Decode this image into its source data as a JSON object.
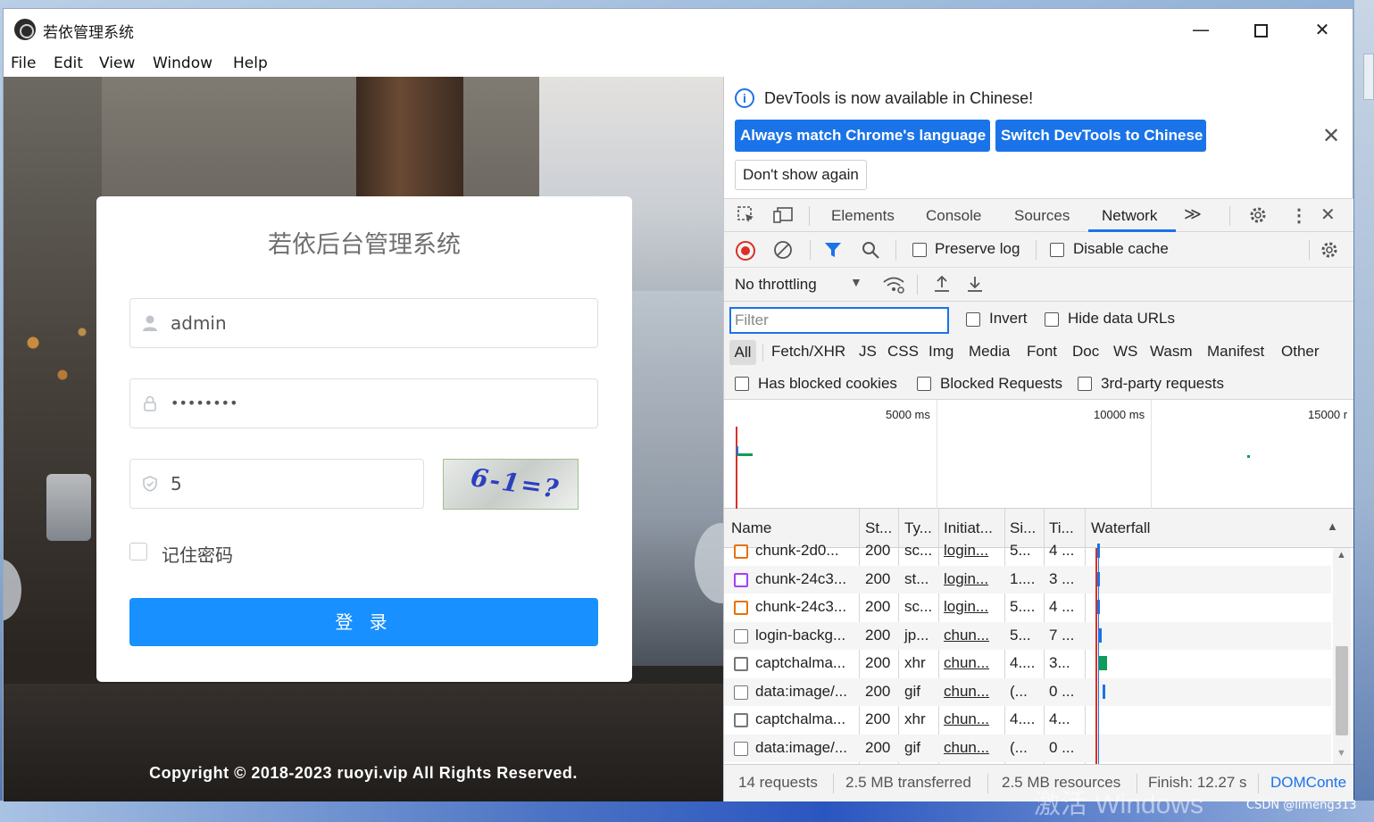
{
  "window": {
    "title": "若依管理系统",
    "min": "—",
    "close": "✕"
  },
  "menu": [
    "File",
    "Edit",
    "View",
    "Window",
    "Help"
  ],
  "login": {
    "title": "若依后台管理系统",
    "username": "admin",
    "password": "••••••••",
    "code": "5",
    "captcha_text": "6-1=?",
    "remember_label": "记住密码",
    "submit_label": "登 录",
    "copyright": "Copyright © 2018-2023 ruoyi.vip All Rights Reserved."
  },
  "devtools": {
    "info_text": "DevTools is now available in Chinese!",
    "btn_match": "Always match Chrome's language",
    "btn_switch": "Switch DevTools to Chinese",
    "btn_dont": "Don't show again",
    "tabs": [
      "Elements",
      "Console",
      "Sources",
      "Network"
    ],
    "more_tabs": "≫",
    "preserve_log": "Preserve log",
    "disable_cache": "Disable cache",
    "throttling": "No throttling",
    "filter_placeholder": "Filter",
    "invert": "Invert",
    "hide_data_urls": "Hide data URLs",
    "types": [
      "All",
      "Fetch/XHR",
      "JS",
      "CSS",
      "Img",
      "Media",
      "Font",
      "Doc",
      "WS",
      "Wasm",
      "Manifest",
      "Other"
    ],
    "has_blocked_cookies": "Has blocked cookies",
    "blocked_requests": "Blocked Requests",
    "third_party": "3rd-party requests",
    "timeline_labels": [
      "5000 ms",
      "10000 ms",
      "15000 r"
    ],
    "columns": [
      "Name",
      "St...",
      "Ty...",
      "Initiat...",
      "Si...",
      "Ti...",
      "Waterfall"
    ],
    "rows": [
      {
        "name": "chunk-2d0...",
        "status": "200",
        "type": "sc...",
        "initiator": "login...",
        "size": "5...",
        "time": "4 ...",
        "icon": "script-icon"
      },
      {
        "name": "chunk-24c3...",
        "status": "200",
        "type": "st...",
        "initiator": "login...",
        "size": "1....",
        "time": "3 ...",
        "icon": "stylesheet-icon"
      },
      {
        "name": "chunk-24c3...",
        "status": "200",
        "type": "sc...",
        "initiator": "login...",
        "size": "5....",
        "time": "4 ...",
        "icon": "script-icon"
      },
      {
        "name": "login-backg...",
        "status": "200",
        "type": "jp...",
        "initiator": "chun...",
        "size": "5...",
        "time": "7 ...",
        "icon": "image-icon"
      },
      {
        "name": "captchalma...",
        "status": "200",
        "type": "xhr",
        "initiator": "chun...",
        "size": "4....",
        "time": "3...",
        "icon": "xhr-icon"
      },
      {
        "name": "data:image/...",
        "status": "200",
        "type": "gif",
        "initiator": "chun...",
        "size": "(...",
        "time": "0 ...",
        "icon": "image-icon"
      },
      {
        "name": "captchalma...",
        "status": "200",
        "type": "xhr",
        "initiator": "chun...",
        "size": "4....",
        "time": "4...",
        "icon": "xhr-icon"
      },
      {
        "name": "data:image/...",
        "status": "200",
        "type": "gif",
        "initiator": "chun...",
        "size": "(...",
        "time": "0 ...",
        "icon": "image-icon"
      }
    ],
    "status": {
      "requests": "14 requests",
      "transferred": "2.5 MB transferred",
      "resources": "2.5 MB resources",
      "finish": "Finish: 12.27 s",
      "domcontent": "DOMConte"
    }
  },
  "watermark": "激活 Windows",
  "credit": "CSDN @limeng313",
  "colors": {
    "accent": "#1a73e8",
    "login_button": "#1890ff",
    "record": "#d93025"
  }
}
